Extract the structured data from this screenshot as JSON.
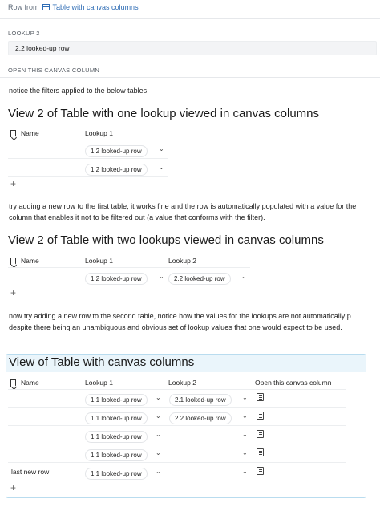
{
  "breadcrumb": {
    "prefix": "Row from",
    "table_name": "Table with canvas columns"
  },
  "lookup2": {
    "label": "LOOKUP 2",
    "value": "2.2 looked-up row"
  },
  "open_canvas_label": "OPEN THIS CANVAS COLUMN",
  "note1": "notice the filters applied to the below tables",
  "section1": {
    "title": "View 2 of Table with one lookup viewed in canvas columns",
    "col_name": "Name",
    "col_lookup1": "Lookup 1",
    "rows": [
      {
        "lookup1": "1.2 looked-up row"
      },
      {
        "lookup1": "1.2 looked-up row"
      }
    ],
    "add": "+"
  },
  "note2_line1": "try adding a new row to the first table, it works fine and the row is automatically populated with a value for the",
  "note2_line2": "column that enables it not to be filtered out (a value that conforms with the filter).",
  "section2": {
    "title": "View 2 of Table with two lookups viewed in canvas columns",
    "col_name": "Name",
    "col_lookup1": "Lookup 1",
    "col_lookup2": "Lookup 2",
    "rows": [
      {
        "lookup1": "1.2 looked-up row",
        "lookup2": "2.2 looked-up row"
      }
    ],
    "add": "+"
  },
  "note3_line1": "now try adding a new row to the second table, notice how the values for the lookups are not automatically p",
  "note3_line2": "despite there being an unambiguous and obvious set of lookup values that one would expect to be used.",
  "section3": {
    "title": "View of Table with canvas columns",
    "col_name": "Name",
    "col_lookup1": "Lookup 1",
    "col_lookup2": "Lookup 2",
    "col_open": "Open this canvas column",
    "rows": [
      {
        "name": "",
        "lookup1": "1.1 looked-up row",
        "lookup2": "2.1 looked-up row"
      },
      {
        "name": "",
        "lookup1": "1.1 looked-up row",
        "lookup2": "2.2 looked-up row"
      },
      {
        "name": "",
        "lookup1": "1.1 looked-up row",
        "lookup2": ""
      },
      {
        "name": "",
        "lookup1": "1.1 looked-up row",
        "lookup2": ""
      },
      {
        "name": "last new row",
        "lookup1": "1.1 looked-up row",
        "lookup2": ""
      }
    ],
    "add": "+"
  },
  "icons": [
    "table-icon",
    "bookmark-icon",
    "chevron-down-icon",
    "document-icon",
    "plus-icon"
  ],
  "colors": {
    "link": "#2f6db5",
    "canvas_border": "#b9dcef",
    "canvas_header_bg": "#eaf5fb"
  }
}
